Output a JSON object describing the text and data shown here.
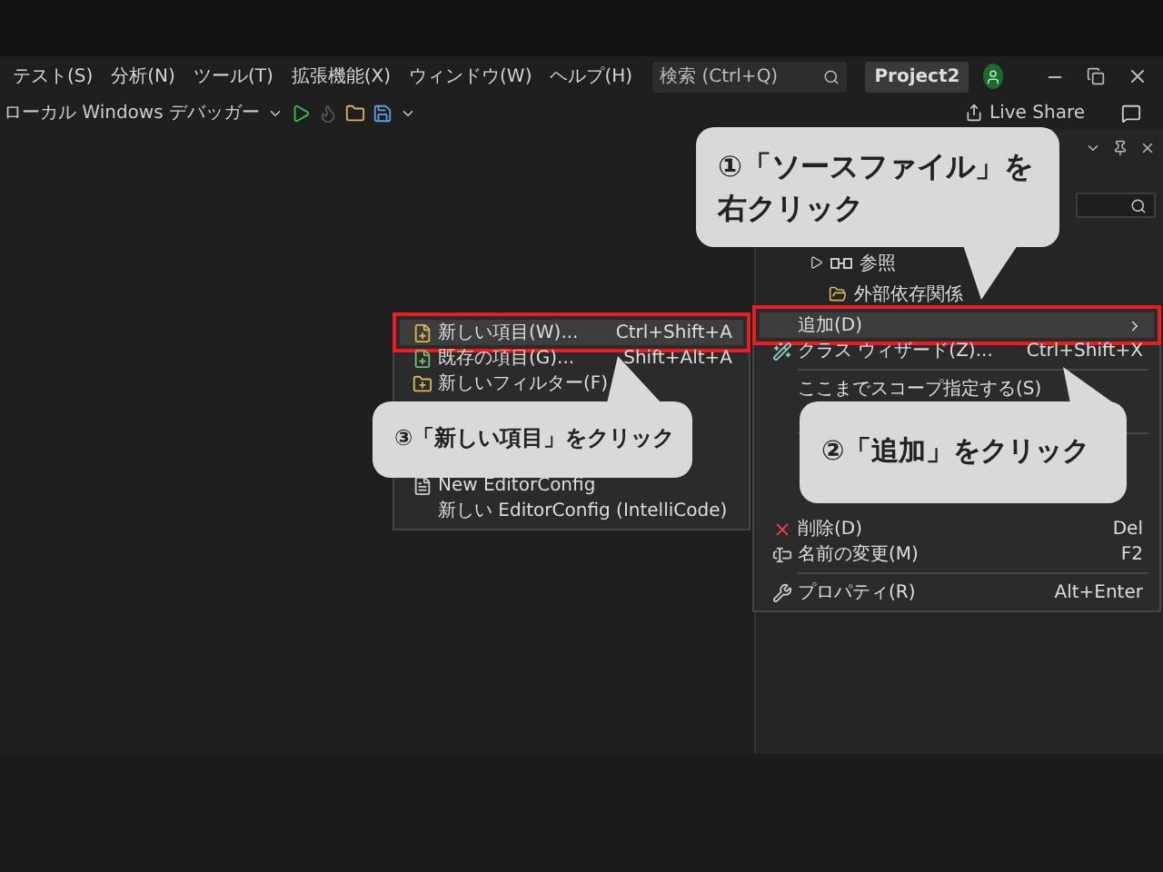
{
  "menu_bar": {
    "items": [
      "テスト(S)",
      "分析(N)",
      "ツール(T)",
      "拡張機能(X)",
      "ウィンドウ(W)",
      "ヘルプ(H)"
    ],
    "search": {
      "placeholder": "検索 (Ctrl+Q)"
    },
    "project": "Project2"
  },
  "toolbar": {
    "debugger": "ローカル Windows デバッガー",
    "live_share": "Live Share"
  },
  "solution_explorer": {
    "tree": [
      {
        "kind": "references",
        "label": "参照",
        "expanded": false
      },
      {
        "kind": "folder",
        "label": "外部依存関係"
      }
    ]
  },
  "context_menu": {
    "items": [
      {
        "kind": "submenu",
        "label": "追加(D)",
        "highlighted": true
      },
      {
        "kind": "wizard",
        "label": "クラス ウィザード(Z)...",
        "shortcut": "Ctrl+Shift+X",
        "highlighted": false
      },
      {
        "kind": "separator"
      },
      {
        "kind": "plain",
        "label": "ここまでスコープ指定する(S)",
        "highlighted": false
      },
      {
        "kind": "covered"
      },
      {
        "kind": "separator"
      },
      {
        "kind": "covered"
      },
      {
        "kind": "covered"
      },
      {
        "kind": "covered"
      },
      {
        "kind": "delete",
        "label": "削除(D)",
        "shortcut": "Del",
        "highlighted": false
      },
      {
        "kind": "rename",
        "label": "名前の変更(M)",
        "shortcut": "F2",
        "highlighted": false
      },
      {
        "kind": "separator"
      },
      {
        "kind": "properties",
        "label": "プロパティ(R)",
        "shortcut": "Alt+Enter",
        "highlighted": false
      }
    ]
  },
  "add_submenu": {
    "items": [
      {
        "kind": "new-item",
        "label": "新しい項目(W)...",
        "shortcut": "Ctrl+Shift+A",
        "highlighted": true
      },
      {
        "kind": "existing-item",
        "label": "既存の項目(G)...",
        "shortcut": "Shift+Alt+A",
        "highlighted": false
      },
      {
        "kind": "filter",
        "label": "新しいフィルター(F)",
        "highlighted": false
      },
      {
        "kind": "covered"
      },
      {
        "kind": "covered"
      },
      {
        "kind": "covered"
      },
      {
        "kind": "file",
        "label": "New EditorConfig",
        "highlighted": false
      },
      {
        "kind": "plain",
        "label": "新しい EditorConfig (IntelliCode)",
        "highlighted": false
      }
    ]
  },
  "callouts": [
    {
      "lines": [
        "①「ソースファイル」を",
        "右クリック"
      ]
    },
    {
      "lines": [
        "③「新しい項目」をクリック"
      ]
    },
    {
      "lines": [
        "②「追加」をクリック"
      ]
    }
  ]
}
